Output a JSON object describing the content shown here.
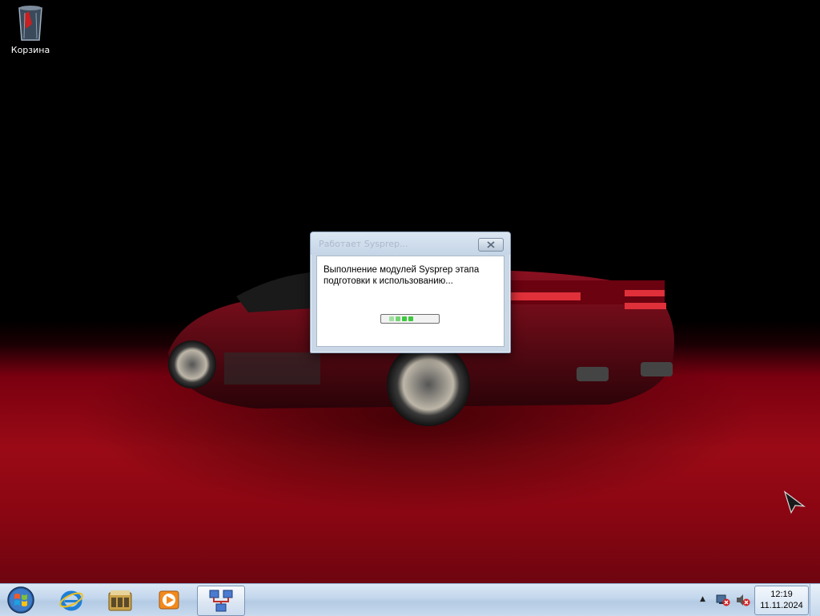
{
  "desktop": {
    "icons": [
      {
        "label": "Корзина",
        "icon": "recycle-bin-icon"
      }
    ]
  },
  "dialog": {
    "title": "Работает Sysprep...",
    "message": "Выполнение модулей Sysprep этапа подготовки к использованию...",
    "close_icon": "close-icon",
    "progress_style": "marquee"
  },
  "taskbar": {
    "start_icon": "windows-logo-icon",
    "pinned": [
      {
        "name": "internet-explorer",
        "icon": "internet-explorer-icon"
      },
      {
        "name": "windows-explorer",
        "icon": "explorer-folder-icon"
      },
      {
        "name": "media-player",
        "icon": "media-player-icon"
      },
      {
        "name": "sysprep",
        "icon": "sysprep-network-icon",
        "active": true
      }
    ],
    "tray": {
      "overflow_icon": "tray-expand-icon",
      "network_icon": "network-disconnected-icon",
      "volume_icon": "volume-muted-icon",
      "time": "12:19",
      "date": "11.11.2024"
    }
  },
  "colors": {
    "accent_red": "#9a0a16",
    "progress_green": "#3fc83f",
    "taskbar_blue": "#c2d6ec"
  }
}
